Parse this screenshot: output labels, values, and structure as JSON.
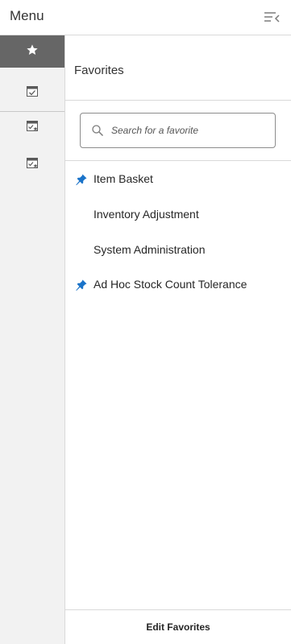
{
  "header": {
    "title": "Menu",
    "collapse_icon": "collapse-menu-icon"
  },
  "rail": {
    "items": [
      {
        "icon": "star-icon",
        "active": true
      },
      {
        "icon": "calendar-check-icon",
        "active": false
      },
      {
        "icon": "calendar-check-star-icon",
        "active": false
      },
      {
        "icon": "calendar-check-star-icon",
        "active": false
      }
    ]
  },
  "panel": {
    "title": "Favorites",
    "search": {
      "placeholder": "Search for a favorite",
      "value": ""
    },
    "items": [
      {
        "label": "Item Basket",
        "pinned": true
      },
      {
        "label": "Inventory Adjustment",
        "pinned": false
      },
      {
        "label": "System Administration",
        "pinned": false
      },
      {
        "label": "Ad Hoc Stock Count Tolerance",
        "pinned": true
      }
    ],
    "footer": {
      "edit_label": "Edit Favorites"
    }
  },
  "colors": {
    "pin": "#1a73c9",
    "active_rail": "#666666",
    "rail_bg": "#f2f2f2"
  }
}
